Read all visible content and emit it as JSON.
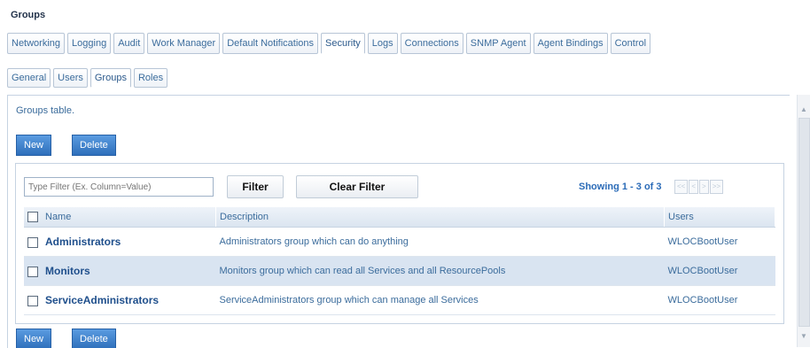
{
  "section": {
    "title": "Groups"
  },
  "main_tabs": [
    {
      "label": "Networking",
      "active": false
    },
    {
      "label": "Logging",
      "active": false
    },
    {
      "label": "Audit",
      "active": false
    },
    {
      "label": "Work Manager",
      "active": false
    },
    {
      "label": "Default Notifications",
      "active": false
    },
    {
      "label": "Security",
      "active": true
    },
    {
      "label": "Logs",
      "active": false
    },
    {
      "label": "Connections",
      "active": false
    },
    {
      "label": "SNMP Agent",
      "active": false
    },
    {
      "label": "Agent Bindings",
      "active": false
    },
    {
      "label": "Control",
      "active": false
    }
  ],
  "sub_tabs": [
    {
      "label": "General",
      "active": false
    },
    {
      "label": "Users",
      "active": false
    },
    {
      "label": "Groups",
      "active": true
    },
    {
      "label": "Roles",
      "active": false
    }
  ],
  "panel": {
    "description": "Groups table."
  },
  "buttons": {
    "new_label": "New",
    "delete_label": "Delete"
  },
  "filter": {
    "placeholder": "Type Filter (Ex. Column=Value)",
    "filter_label": "Filter",
    "clear_label": "Clear Filter"
  },
  "pagination": {
    "showing": "Showing 1 - 3 of 3",
    "first": "<<",
    "prev": "<",
    "next": ">",
    "last": ">>"
  },
  "table": {
    "columns": [
      "Name",
      "Description",
      "Users"
    ],
    "rows": [
      {
        "name": "Administrators",
        "description": "Administrators group which can do anything",
        "users": "WLOCBootUser",
        "selected": false
      },
      {
        "name": "Monitors",
        "description": "Monitors group which can read all Services and all ResourcePools",
        "users": "WLOCBootUser",
        "selected": true
      },
      {
        "name": "ServiceAdministrators",
        "description": "ServiceAdministrators group which can manage all Services",
        "users": "WLOCBootUser",
        "selected": false
      }
    ]
  },
  "colors": {
    "accent": "#2e6fbb",
    "tab_text": "#3b6c9c",
    "selected_row": "#d9e4f1"
  }
}
